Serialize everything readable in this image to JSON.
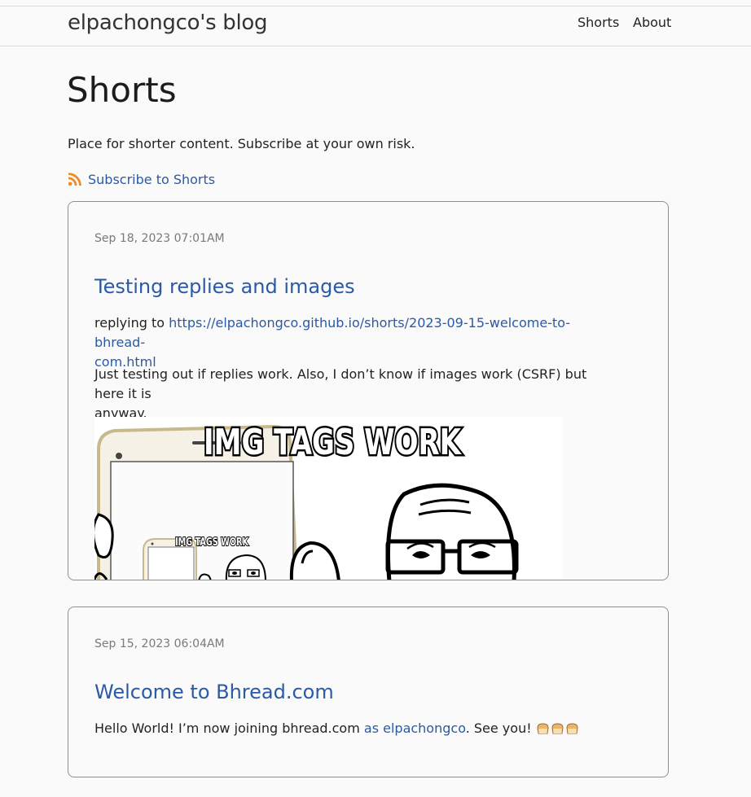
{
  "site": {
    "brand": "elpachongco's blog"
  },
  "nav": {
    "items": [
      "Shorts",
      "About"
    ]
  },
  "page": {
    "title": "Shorts",
    "intro": "Place for shorter content. Subscribe at your own risk.",
    "subscribe_label": "Subscribe to Shorts"
  },
  "posts": [
    {
      "date": "Sep 18, 2023 07:01AM",
      "title": "Testing replies and images",
      "reply_prefix": "replying to ",
      "reply_url_line1": "https://elpachongco.github.io/shorts/2023-09-15-welcome-to-bhread-",
      "reply_url_line2": "com.html",
      "body_line1": "Just testing out if replies work. Also, I don’t know if images work (CSRF) but here it is",
      "body_line2": "anyway.",
      "image_caption": "IMG TAGS WORK",
      "image_caption_small": "IMG TAGS WORK"
    },
    {
      "date": "Sep 15, 2023 06:04AM",
      "title": "Welcome to Bhread.com",
      "body_before": "Hello World! I’m now joining bhread.com ",
      "body_link": "as elpachongco",
      "body_after": ". See you! "
    }
  ],
  "colors": {
    "link": "#2a5aa6",
    "rss": "#f08a24",
    "border": "#8f8f8f"
  },
  "icons": {
    "rss": "rss-icon",
    "bread": "bread-emoji-icon"
  }
}
